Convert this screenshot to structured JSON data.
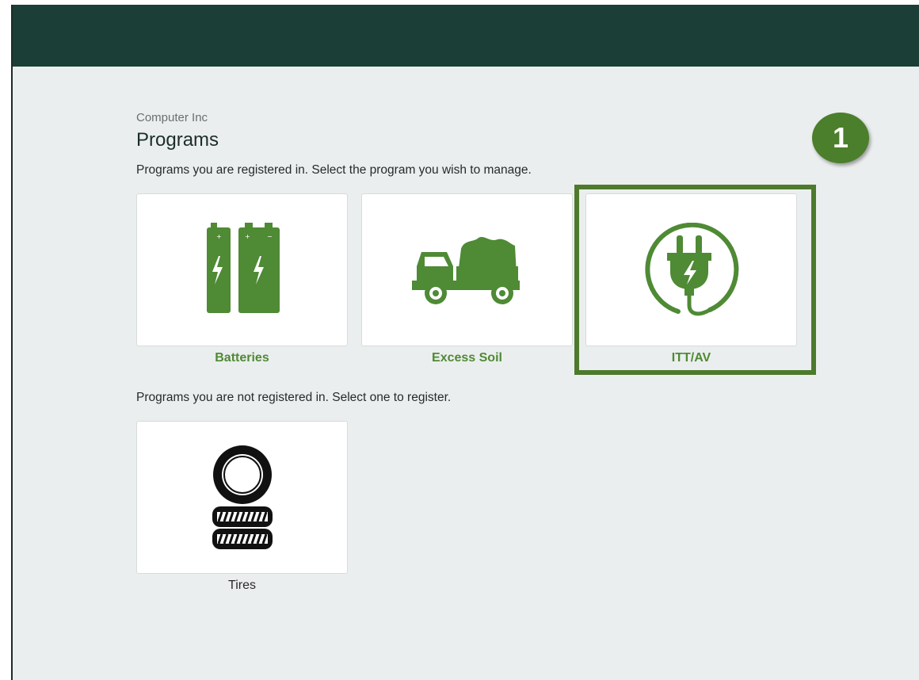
{
  "header": {
    "company": "Computer Inc",
    "title": "Programs"
  },
  "registered": {
    "text": "Programs you are registered in. Select the program you wish to manage.",
    "programs": [
      {
        "label": "Batteries",
        "icon": "battery-icon"
      },
      {
        "label": "Excess Soil",
        "icon": "dump-truck-icon"
      },
      {
        "label": "ITT/AV",
        "icon": "electric-plug-icon"
      }
    ]
  },
  "unregistered": {
    "text": "Programs you are not registered in. Select one to register.",
    "programs": [
      {
        "label": "Tires",
        "icon": "tires-icon"
      }
    ]
  },
  "annotation": {
    "step": "1"
  },
  "colors": {
    "topbar": "#1b3e36",
    "brand_green": "#4f8a35",
    "highlight": "#4d7a2d",
    "background": "#ebeeee"
  }
}
